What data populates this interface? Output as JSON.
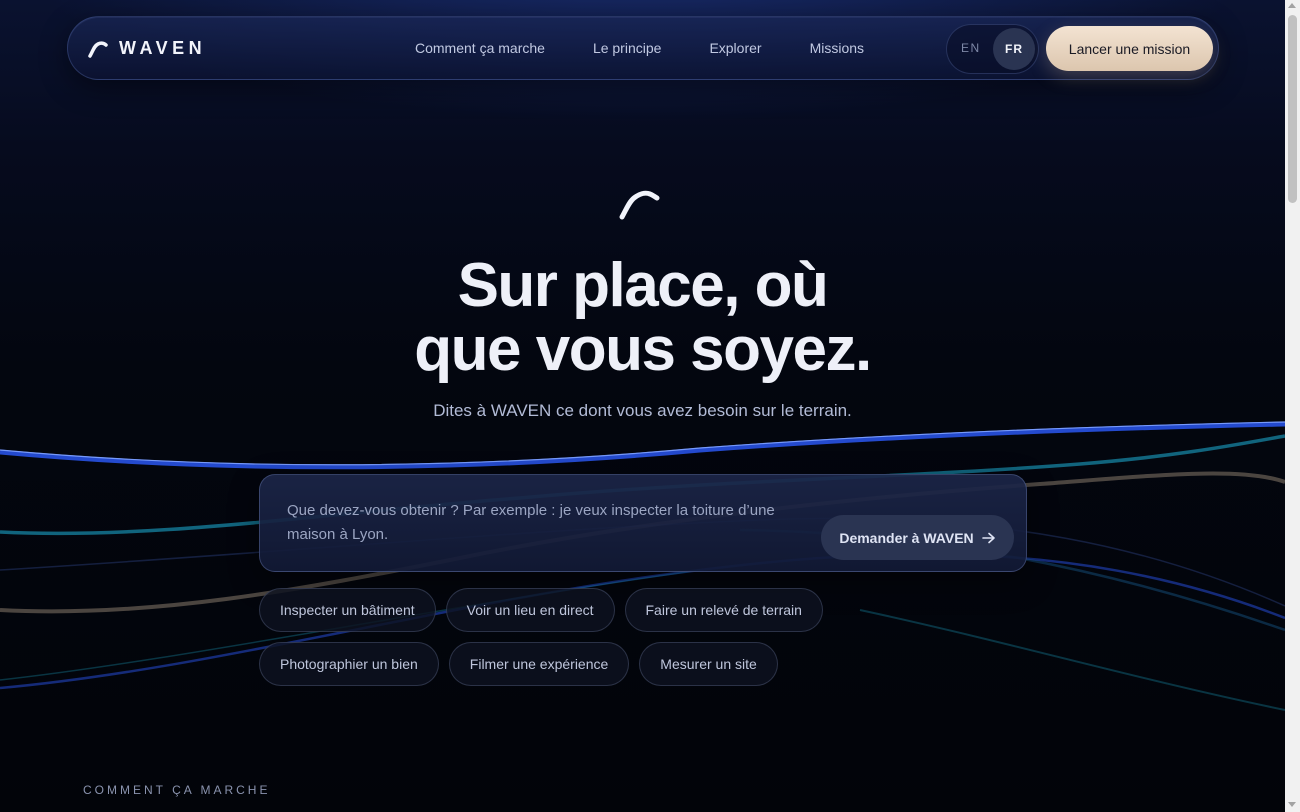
{
  "brand": {
    "name": "WAVEN",
    "logo_icon": "wave-logo-icon"
  },
  "nav": {
    "links": [
      "Comment ça marche",
      "Le principe",
      "Explorer",
      "Missions"
    ],
    "languages": {
      "en": "EN",
      "fr": "FR",
      "active": "FR"
    },
    "cta": "Lancer une mission"
  },
  "hero": {
    "icon": "wave-icon",
    "title_line1": "Sur place, où",
    "title_line2": "que vous soyez.",
    "subtitle": "Dites à WAVEN ce dont vous avez besoin sur le terrain."
  },
  "prompt": {
    "placeholder": "Que devez-vous obtenir ? Par exemple : je veux inspecter la toiture d’une maison à Lyon.",
    "value": "",
    "submit_label": "Demander à WAVEN",
    "submit_icon": "arrow-right-icon"
  },
  "suggestions": [
    [
      "Inspecter un bâtiment",
      "Voir un lieu en direct",
      "Faire un relevé de terrain"
    ],
    [
      "Photographier un bien",
      "Filmer une expérience",
      "Mesurer un site"
    ]
  ],
  "section_label": "COMMENT ÇA MARCHE",
  "colors": {
    "background": "#03050d",
    "cta_bg": "#e8d5c0",
    "button_dark": "#2a3452",
    "wave_blue": "#2d5bff",
    "wave_teal": "#1aa4c8",
    "wave_sand": "#b8a48e"
  }
}
